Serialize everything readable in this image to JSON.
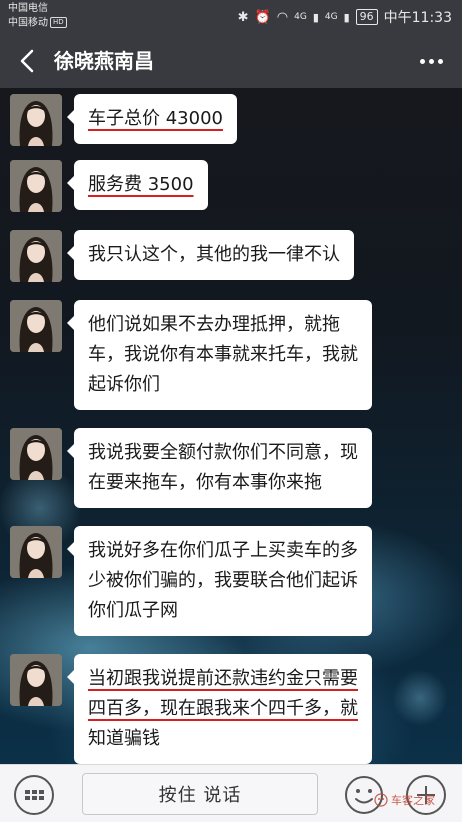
{
  "status_bar": {
    "carrier_1": "中国电信",
    "carrier_2": "中国移动",
    "hd_badge": "HD",
    "net_1": "4G",
    "net_2": "4G",
    "battery": "96",
    "time": "中午11:33"
  },
  "title_bar": {
    "title": "徐晓燕南昌"
  },
  "messages": [
    {
      "segments": [
        "车子总价 43000"
      ]
    },
    {
      "segments": [
        "服务费 3500"
      ]
    },
    {
      "segments": [
        "我只认这个，其他的我一律不认"
      ]
    },
    {
      "lines": [
        "他们说如果不去办理抵押，就拖",
        "车，我说你有本事就来托车，我就",
        "起诉你们"
      ]
    },
    {
      "lines": [
        "我说我要全额付款你们不同意，现",
        "在要来拖车，你有本事你来拖"
      ]
    },
    {
      "lines": [
        "我说好多在你们瓜子上买卖车的多",
        "少被你们骗的，我要联合他们起诉",
        "你们瓜子网"
      ]
    },
    {
      "lines": [
        "当初跟我说提前还款违约金只需要",
        "四百多，现在跟我来个四千多，就",
        "知道骗钱"
      ]
    }
  ],
  "input_bar": {
    "voice_label": "按住 说话"
  },
  "watermark": {
    "text": "车客之家"
  },
  "colors": {
    "bar_bg": "#393a3f",
    "bubble_bg": "#ffffff",
    "underline": "#d62020"
  }
}
